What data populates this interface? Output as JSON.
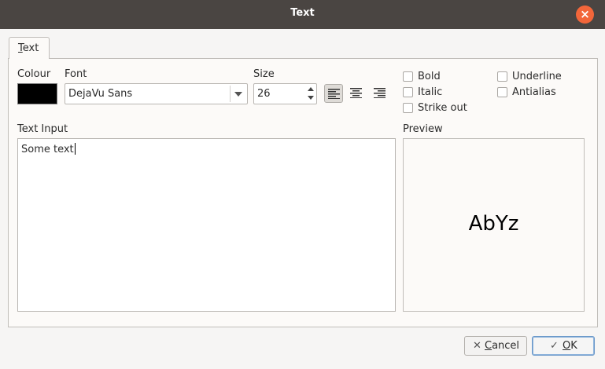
{
  "window": {
    "title": "Text",
    "close_glyph": "×",
    "close_icon": "close-icon"
  },
  "tabs": [
    {
      "label": "Text",
      "mnemonic": "T"
    }
  ],
  "colour": {
    "label": "Colour",
    "value": "#000000"
  },
  "font": {
    "label": "Font",
    "value": "DejaVu Sans"
  },
  "size": {
    "label": "Size",
    "value": "26"
  },
  "alignment": {
    "selected": "left",
    "options": [
      "left",
      "center",
      "right"
    ]
  },
  "options": {
    "bold": {
      "label": "Bold",
      "checked": false
    },
    "italic": {
      "label": "Italic",
      "checked": false
    },
    "strikeout": {
      "label": "Strike out",
      "checked": false
    },
    "underline": {
      "label": "Underline",
      "checked": false
    },
    "antialias": {
      "label": "Antialias",
      "checked": false
    }
  },
  "text_input": {
    "label": "Text Input",
    "value": "Some text"
  },
  "preview": {
    "label": "Preview",
    "sample": "AbYz"
  },
  "buttons": {
    "cancel": {
      "label": "Cancel",
      "icon": "x-icon",
      "glyph": "✕"
    },
    "ok": {
      "label": "OK",
      "icon": "check-icon",
      "glyph": "✓"
    }
  }
}
